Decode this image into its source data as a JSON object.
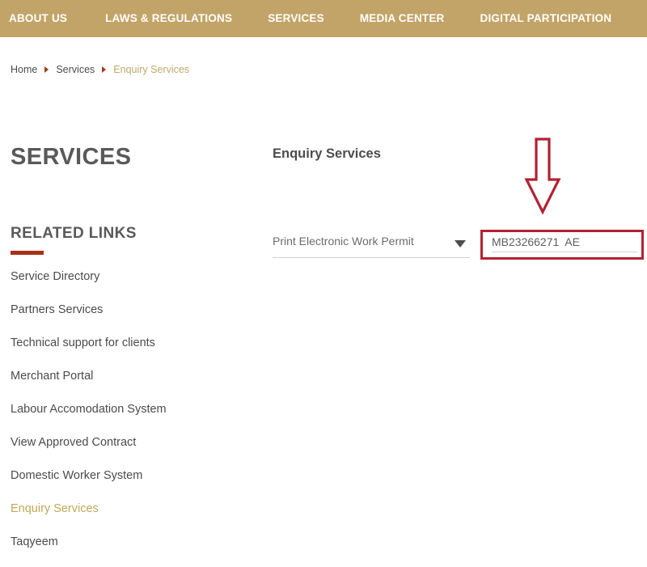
{
  "nav": {
    "items": [
      {
        "label": "ABOUT US",
        "name": "nav-item-about-us"
      },
      {
        "label": "LAWS & REGULATIONS",
        "name": "nav-item-laws-regulations"
      },
      {
        "label": "SERVICES",
        "name": "nav-item-services"
      },
      {
        "label": "MEDIA CENTER",
        "name": "nav-item-media-center"
      },
      {
        "label": "DIGITAL PARTICIPATION",
        "name": "nav-item-digital-participation"
      }
    ],
    "background_color": "#c3a468",
    "text_color": "#ffffff"
  },
  "breadcrumb": {
    "items": [
      {
        "label": "Home",
        "current": false
      },
      {
        "label": "Services",
        "current": false
      },
      {
        "label": "Enquiry Services",
        "current": true
      }
    ],
    "separator_icon": "triangle-right-icon",
    "separator_color": "#a03a22",
    "current_color": "#bfa76a"
  },
  "sidebar": {
    "page_title": "SERVICES",
    "related_links_title": "RELATED LINKS",
    "rule_color": "#a93016",
    "items": [
      {
        "label": "Service Directory",
        "active": false
      },
      {
        "label": "Partners Services",
        "active": false
      },
      {
        "label": "Technical support for clients",
        "active": false
      },
      {
        "label": "Merchant Portal",
        "active": false
      },
      {
        "label": "Labour Accomodation System",
        "active": false
      },
      {
        "label": "View Approved Contract",
        "active": false
      },
      {
        "label": "Domestic Worker System",
        "active": false
      },
      {
        "label": "Enquiry Services",
        "active": true
      },
      {
        "label": "Taqyeem",
        "active": false
      }
    ],
    "active_color": "#bfa855",
    "link_color": "#4b4b4b"
  },
  "main": {
    "heading": "Enquiry Services",
    "service_select": {
      "selected": "Print Electronic Work Permit",
      "caret_icon": "chevron-down-icon"
    },
    "permit_input": {
      "value": "MB23266271  AE",
      "placeholder": ""
    }
  },
  "annotations": {
    "color": "#b22234",
    "arrow_icon": "arrow-down-outline-icon",
    "highlight_box_target": "permit-input"
  }
}
